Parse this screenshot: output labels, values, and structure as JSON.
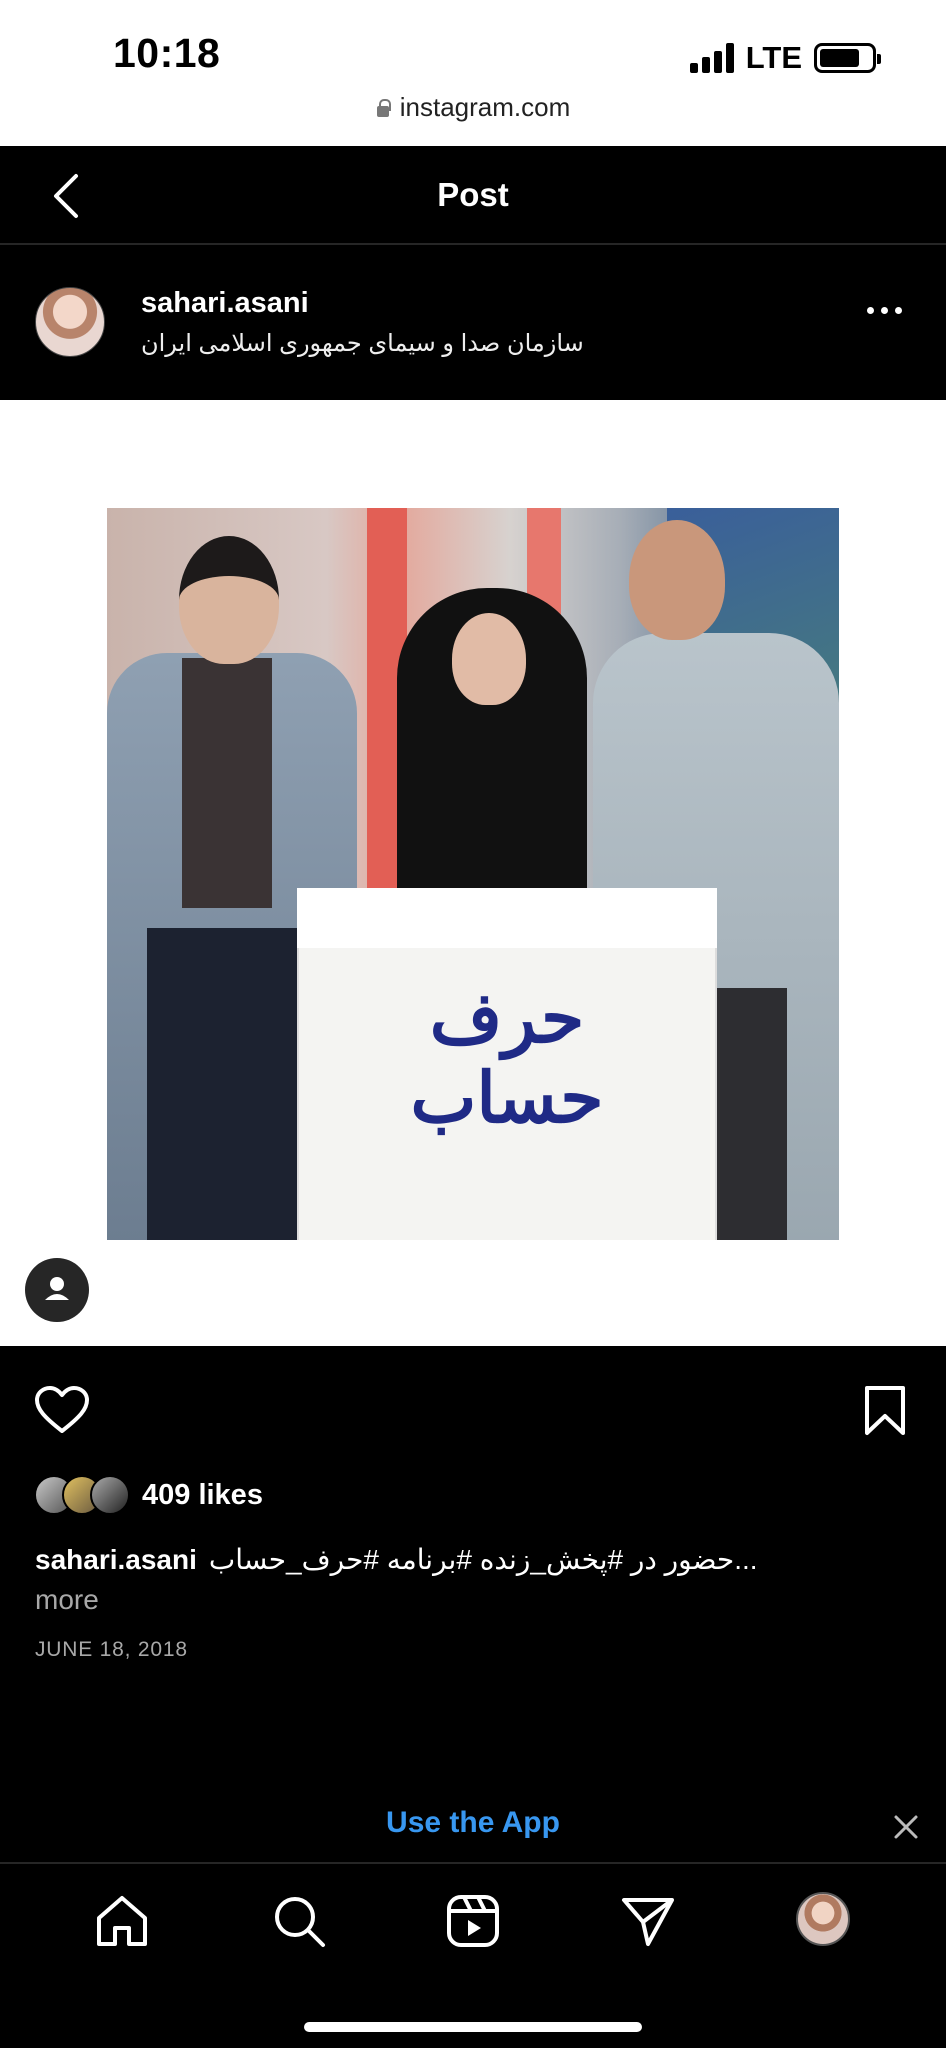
{
  "status_bar": {
    "time": "10:18",
    "network": "LTE",
    "battery_level": 0.78
  },
  "browser": {
    "url": "instagram.com"
  },
  "nav": {
    "title": "Post"
  },
  "post": {
    "username": "sahari.asani",
    "location": "سازمان صدا و سیمای جمهوری اسلامی ایران",
    "image_text": "حرف حساب",
    "likes": "409 likes",
    "caption_username": "sahari.asani",
    "caption_text": "حضور در #پخش_زنده #برنامه #حرف_حساب...",
    "more_label": "more",
    "date": "JUNE 18, 2018"
  },
  "banner": {
    "use_app_label": "Use the App"
  },
  "icons": {
    "back": "chevron-left-icon",
    "more": "more-horizontal-icon",
    "tag_user": "user-tag-icon",
    "heart": "heart-icon",
    "bookmark": "bookmark-icon",
    "close": "close-icon",
    "tabs": [
      "home-icon",
      "search-icon",
      "reels-icon",
      "direct-icon",
      "profile-avatar"
    ]
  },
  "colors": {
    "background": "#000000",
    "link": "#3897f0",
    "muted": "#a8a8a8"
  }
}
